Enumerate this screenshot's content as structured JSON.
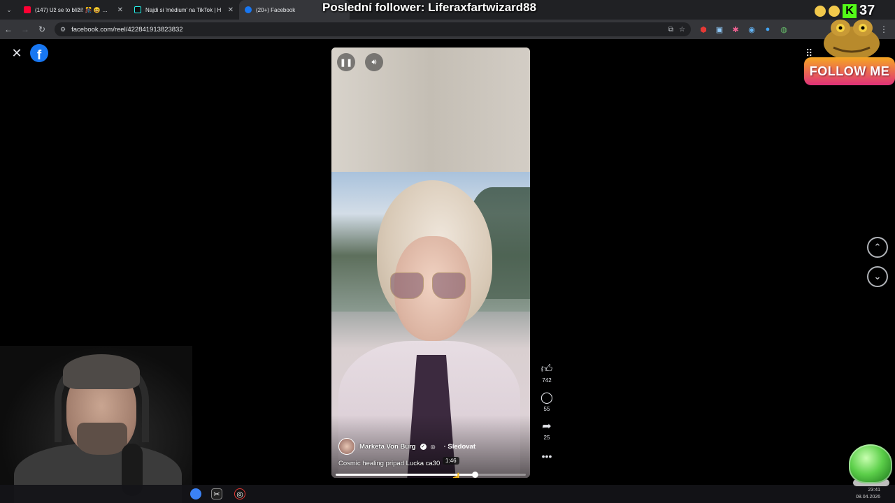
{
  "browser": {
    "tabs": [
      {
        "label": "(147) Už se to blíží! 🎊 😄 🥚 #co",
        "favicon_color": "#ff0033",
        "active": false
      },
      {
        "label": "Najdi si 'médium' na TikTok | H",
        "favicon_color": "#111111",
        "active": false
      },
      {
        "label": "(20+) Facebook",
        "favicon_color": "#1877f2",
        "active": true
      }
    ],
    "url": "facebook.com/reel/422841913823832"
  },
  "stream_overlay": {
    "last_follower": "Poslední follower: Liferaxfartwizard88",
    "kick_viewer_count": "37",
    "follow_me": "FOLLOW ME"
  },
  "reel": {
    "author_name": "Marketa Von Burg",
    "follow_label": "· Sledovat",
    "caption": "Cosmic healing pripad Lucka ca30",
    "hover_time": "1:46",
    "progress_fraction": 0.73,
    "hover_fraction": 0.61,
    "likes": "742",
    "comments": "55",
    "shares": "25"
  },
  "taskbar": {
    "time": "23:41",
    "date": "08.04.2026"
  },
  "colors": {
    "facebook_blue": "#1877f2",
    "kick_green": "#53fc18"
  }
}
